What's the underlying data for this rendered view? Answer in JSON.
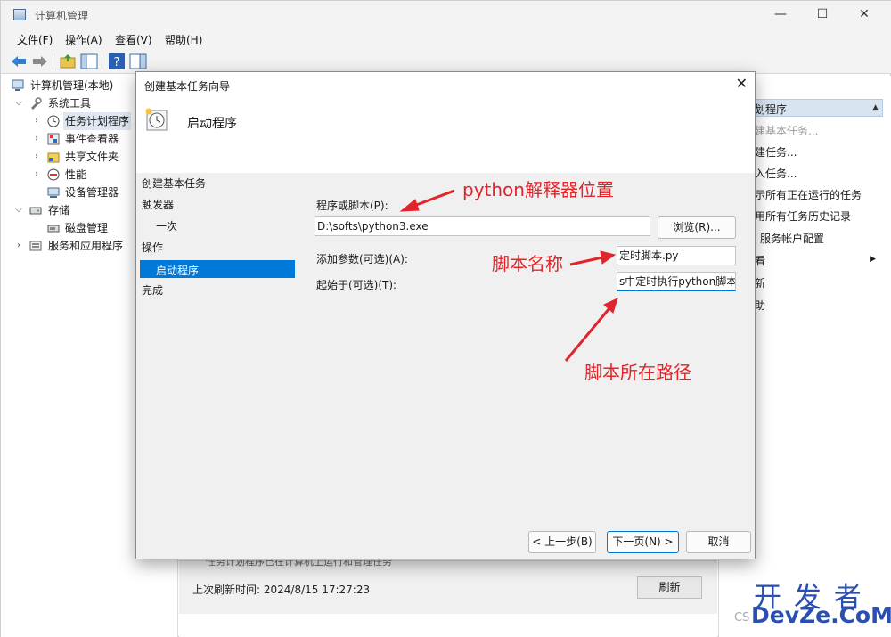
{
  "window": {
    "title": "计算机管理",
    "controls": {
      "minimize": "—",
      "maximize": "☐",
      "close": "✕"
    }
  },
  "menu": [
    "文件(F)",
    "操作(A)",
    "查看(V)",
    "帮助(H)"
  ],
  "tree": {
    "root": "计算机管理(本地)",
    "system_tools": "系统工具",
    "task_scheduler": "任务计划程序",
    "event_viewer": "事件查看器",
    "shared_folders": "共享文件夹",
    "performance": "性能",
    "device_manager": "设备管理器",
    "storage": "存储",
    "disk_management": "磁盘管理",
    "services_apps": "服务和应用程序"
  },
  "actions": {
    "header": "划程序",
    "items": [
      "建基本任务...",
      "建任务...",
      "入任务...",
      "示所有正在运行的任务",
      "用所有任务历史记录",
      "服务帐户配置",
      "看",
      "新",
      "助"
    ]
  },
  "center": {
    "hidden_text": "任务计划程序已在计算机上运行和管理任务",
    "last_refresh": "上次刷新时间: 2024/8/15 17:27:23",
    "refresh_button": "刷新"
  },
  "dialog": {
    "title": "创建基本任务向导",
    "header": "启动程序",
    "steps": [
      "创建基本任务",
      "触发器",
      "一次",
      "操作",
      "启动程序",
      "完成"
    ],
    "program_label": "程序或脚本(P):",
    "program_value": "D:\\softs\\python3.exe",
    "browse_button": "浏览(R)...",
    "args_label": "添加参数(可选)(A):",
    "args_value": "定时脚本.py",
    "start_label": "起始于(可选)(T):",
    "start_value": "s中定时执行python脚本",
    "back_button": "< 上一步(B)",
    "next_button": "下一页(N) >",
    "cancel_button": "取消"
  },
  "annotations": {
    "interpreter": "python解释器位置",
    "script_name": "脚本名称",
    "script_path": "脚本所在路径",
    "color": "#e0252b"
  },
  "watermark": {
    "top": "开 发 者",
    "bottom": "DevZe.CoM",
    "prefix": "CS"
  }
}
